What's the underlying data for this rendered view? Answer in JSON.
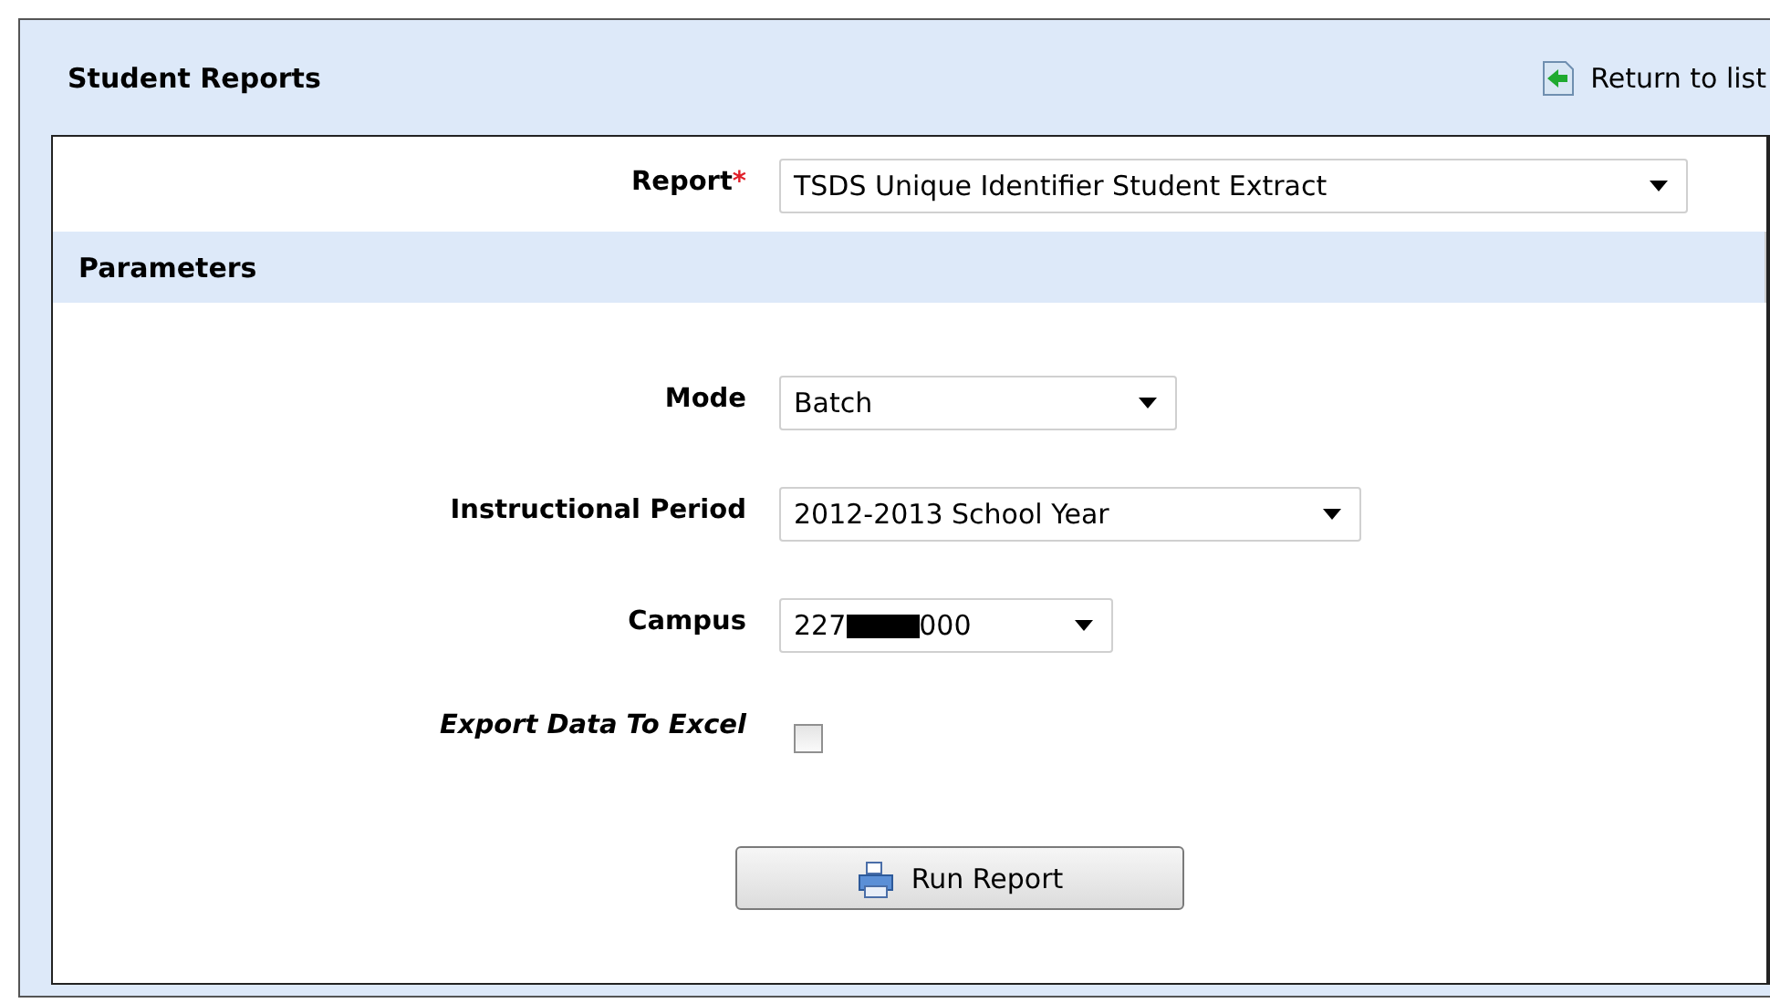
{
  "header": {
    "title": "Student Reports",
    "return_link": "Return to list"
  },
  "report": {
    "label": "Report",
    "required_mark": "*",
    "value": "TSDS Unique Identifier Student Extract"
  },
  "parameters_title": "Parameters",
  "fields": [
    {
      "kind": "select",
      "label": "Mode",
      "value": "Batch"
    },
    {
      "kind": "select",
      "label": "Instructional Period",
      "value": "2012-2013 School Year"
    },
    {
      "kind": "select",
      "label": "Campus",
      "value": "227",
      "redacted": true,
      "value_end": "000"
    },
    {
      "kind": "checkbox",
      "label": "Export Data To Excel",
      "checked": false
    }
  ],
  "run_button": "Run Report"
}
